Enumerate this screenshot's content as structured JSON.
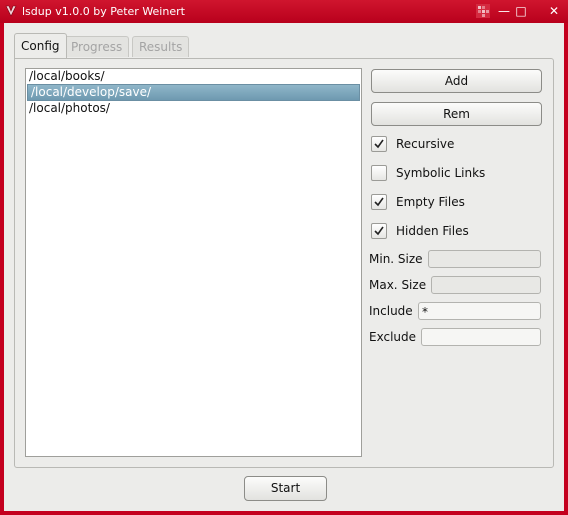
{
  "window": {
    "title": "lsdup v1.0.0 by Peter Weinert",
    "buttons": {
      "minimize": "—",
      "maximize": "□",
      "close": "✕"
    }
  },
  "tabs": [
    {
      "label": "Config",
      "active": true
    },
    {
      "label": "Progress",
      "active": false
    },
    {
      "label": "Results",
      "active": false
    }
  ],
  "paths": {
    "items": [
      "/local/books/",
      "/local/develop/save/",
      "/local/photos/"
    ],
    "selected_index": 1
  },
  "buttons": {
    "add": "Add",
    "rem": "Rem",
    "start": "Start"
  },
  "options": [
    {
      "label": "Recursive",
      "checked": true
    },
    {
      "label": "Symbolic Links",
      "checked": false
    },
    {
      "label": "Empty Files",
      "checked": true
    },
    {
      "label": "Hidden Files",
      "checked": true
    }
  ],
  "fields": {
    "min_size": {
      "label": "Min. Size",
      "value": ""
    },
    "max_size": {
      "label": "Max. Size",
      "value": ""
    },
    "include": {
      "label": "Include",
      "value": "*"
    },
    "exclude": {
      "label": "Exclude",
      "value": ""
    }
  },
  "colors": {
    "titlebar": "#c4001e",
    "selection": "#7ea8bd",
    "background": "#ececea"
  }
}
